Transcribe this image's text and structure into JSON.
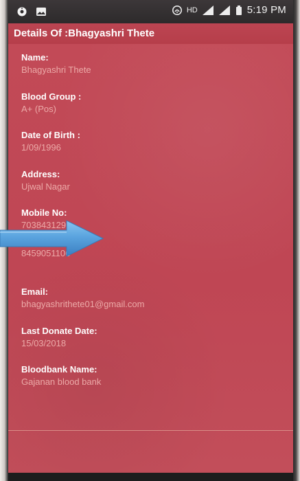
{
  "status": {
    "left_icons": [
      "settings-icon",
      "image-icon"
    ],
    "right_icons": [
      "wifi-icon",
      "hd-icon",
      "signal-icon",
      "signal-icon",
      "battery-icon"
    ],
    "hd": "HD",
    "time": "5:19 PM"
  },
  "header": {
    "title": "Details Of :Bhagyashri Thete"
  },
  "details": {
    "fields": [
      {
        "label": "Name:",
        "value": "Bhagyashri Thete"
      },
      {
        "label": "Blood Group :",
        "value": "A+ (Pos)"
      },
      {
        "label": "Date of Birth :",
        "value": "1/09/1996"
      },
      {
        "label": "Address:",
        "value": "Ujwal Nagar"
      },
      {
        "label": "Mobile No:",
        "value": "7038431295"
      },
      {
        "label": "",
        "value": "8459051106"
      },
      {
        "label": "Email:",
        "value": "bhagyashrithete01@gmail.com"
      },
      {
        "label": "Last Donate Date:",
        "value": "15/03/2018"
      },
      {
        "label": "Bloodbank Name:",
        "value": "Gajanan blood bank"
      }
    ]
  },
  "colors": {
    "background": "#c04855",
    "header": "#b63e4a",
    "label": "#ffffff",
    "value": "#ecaaa8",
    "arrow": "#5aa4df"
  },
  "annotation": {
    "arrow_icon": "arrow-right-icon"
  }
}
